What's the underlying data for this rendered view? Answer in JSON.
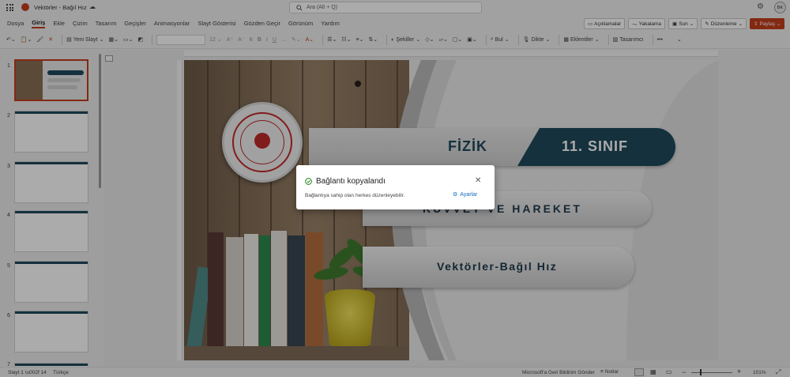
{
  "title_bar": {
    "doc_title": "Vektörler - Bağıl Hız",
    "search_placeholder": "Ara (Alt + Q)",
    "user_initials": "BK"
  },
  "ribbon": {
    "tabs": [
      "Dosya",
      "Giriş",
      "Ekle",
      "Çizim",
      "Tasarım",
      "Geçişler",
      "Animasyonlar",
      "Slayt Gösterisi",
      "Gözden Geçir",
      "Görünüm",
      "Yardım"
    ],
    "active_tab": "Giriş",
    "right_buttons": {
      "comments": "Açıklamalar",
      "catch_up": "Yakalama",
      "present": "Sun",
      "editing": "Düzenleme",
      "share": "Paylaş"
    }
  },
  "toolbar": {
    "new_slide": "Yeni Slayt",
    "font_size": "12",
    "shapes": "Şekiller",
    "dictate": "Dikte",
    "addins": "Eklentiler",
    "designer": "Tasarımcı",
    "find": "Bul"
  },
  "thumbnails": {
    "numbers": [
      "1",
      "2",
      "3",
      "4",
      "5",
      "6",
      "7"
    ]
  },
  "slide": {
    "subject": "FİZİK",
    "grade": "11. SINIF",
    "topic": "KUVVET VE HAREKET",
    "lesson": "Vektörler-Bağıl Hız"
  },
  "toast": {
    "title": "Bağlantı kopyalandı",
    "message": "Bağlantıya sahip olan herkes düzenleyebilir.",
    "settings_label": "Ayarlar"
  },
  "status_bar": {
    "slide_info": "Slayt 1 \\u002f 14",
    "language": "Türkçe",
    "feedback": "Microsoft'a Geri Bildirim Gönder",
    "notes": "Notlar",
    "zoom": "101%"
  },
  "colors": {
    "brand": "#c43e1c",
    "slide_teal": "#1e4a5c",
    "accent_link": "#0f6cbd",
    "success_green": "#107c10"
  }
}
